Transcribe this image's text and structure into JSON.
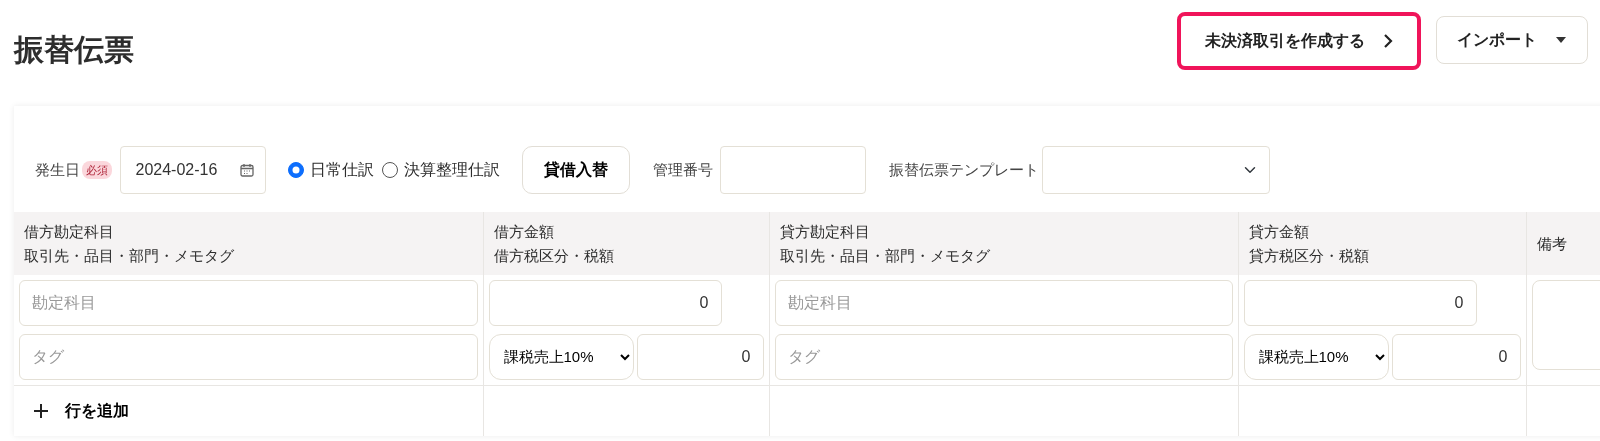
{
  "title": "振替伝票",
  "header_buttons": [
    {
      "label": "未決済取引を作成する",
      "kind": "link",
      "highlighted": true
    },
    {
      "label": "インポート",
      "kind": "dropdown",
      "highlighted": false
    }
  ],
  "form": {
    "date_label": "発生日",
    "required_badge": "必須",
    "date": "2024-02-16",
    "entry_types": [
      {
        "label": "日常仕訳",
        "selected": true
      },
      {
        "label": "決算整理仕訳",
        "selected": false
      }
    ],
    "swap_button": "貸借入替",
    "number_label": "管理番号",
    "template_label": "振替伝票テンプレート"
  },
  "table": {
    "columns": [
      {
        "line_1": "借方勘定科目",
        "line_2": "取引先・品目・部門・メモタグ"
      },
      {
        "line_1": "借方金額",
        "line_2": "借方税区分・税額"
      },
      {
        "line_1": "貸方勘定科目",
        "line_2": "取引先・品目・部門・メモタグ"
      },
      {
        "line_1": "貸方金額",
        "line_2": "貸方税区分・税額"
      },
      {
        "line_1": "備考"
      }
    ],
    "sides": [
      {
        "account_placeholder": "勘定科目",
        "tag_placeholder": "タグ",
        "amount": "0",
        "tax_category": "課税売上10%",
        "tax_amount": "0"
      },
      {
        "account_placeholder": "勘定科目",
        "tag_placeholder": "タグ",
        "amount": "0",
        "tax_category": "課税売上10%",
        "tax_amount": "0"
      }
    ],
    "add_row": "行を追加"
  }
}
